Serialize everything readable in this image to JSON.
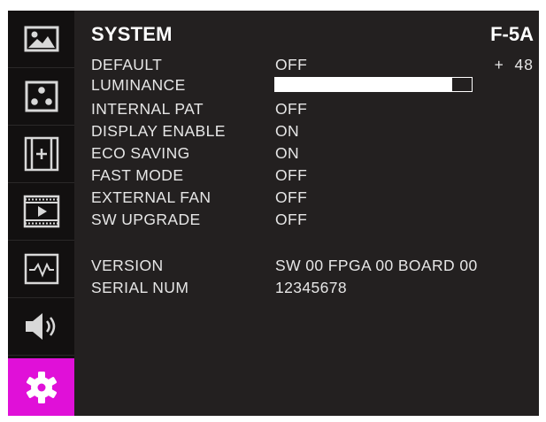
{
  "header": {
    "title": "SYSTEM",
    "model": "F-5A"
  },
  "sidebar": {
    "items": [
      {
        "icon": "picture-icon",
        "active": false
      },
      {
        "icon": "pattern-icon",
        "active": false
      },
      {
        "icon": "marker-icon",
        "active": false
      },
      {
        "icon": "video-icon",
        "active": false
      },
      {
        "icon": "waveform-icon",
        "active": false
      },
      {
        "icon": "speaker-icon",
        "active": false
      },
      {
        "icon": "gear-icon",
        "active": true
      }
    ],
    "active_color": "#e010d8"
  },
  "menu": {
    "default": {
      "label": "DEFAULT",
      "value": "OFF",
      "extra": "+  48"
    },
    "luminance": {
      "label": "LUMINANCE",
      "level": 0.9
    },
    "internal_pat": {
      "label": "INTERNAL PAT",
      "value": "OFF"
    },
    "display_enable": {
      "label": "DISPLAY ENABLE",
      "value": "ON"
    },
    "eco_saving": {
      "label": "ECO SAVING",
      "value": "ON"
    },
    "fast_mode": {
      "label": "FAST MODE",
      "value": "OFF"
    },
    "external_fan": {
      "label": "EXTERNAL FAN",
      "value": "OFF"
    },
    "sw_upgrade": {
      "label": "SW UPGRADE",
      "value": "OFF"
    }
  },
  "info": {
    "version": {
      "label": "VERSION",
      "value": "SW 00 FPGA 00 BOARD 00"
    },
    "serial": {
      "label": "SERIAL NUM",
      "value": "12345678"
    }
  }
}
